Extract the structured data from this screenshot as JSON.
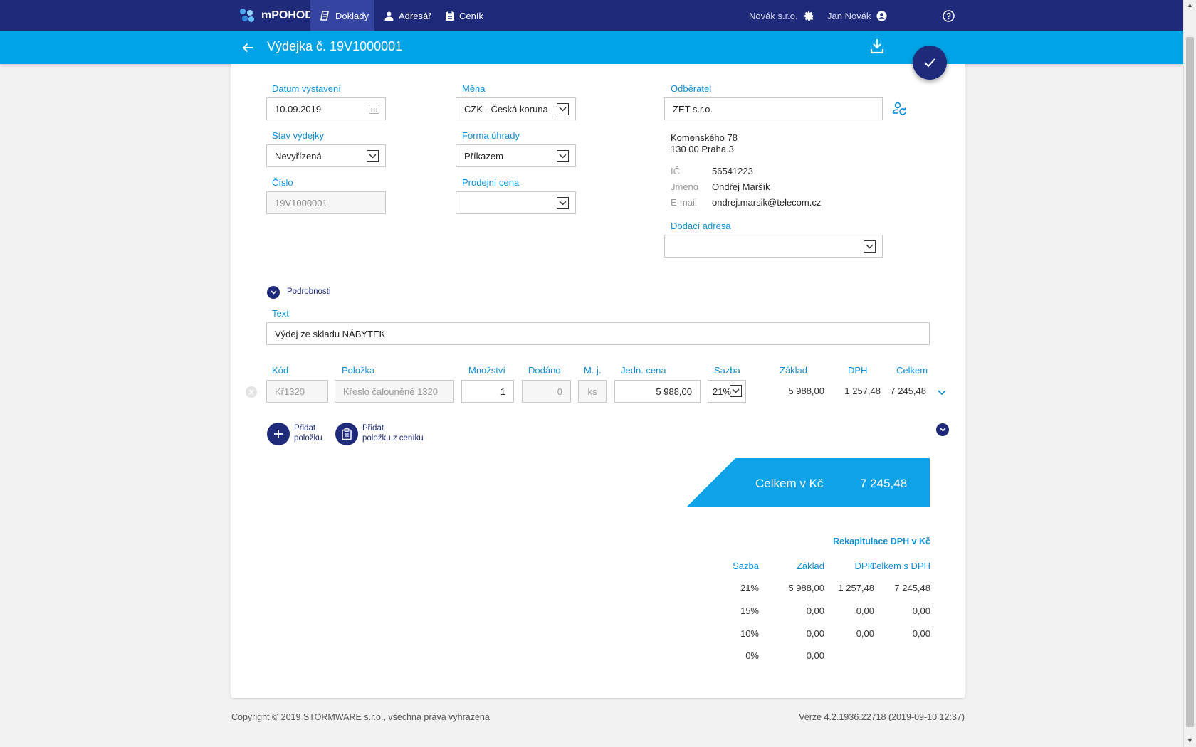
{
  "app": {
    "brand": "mPOHODA",
    "nav": [
      {
        "label": "Doklady",
        "icon": "documents-icon"
      },
      {
        "label": "Adresář",
        "icon": "person-icon"
      },
      {
        "label": "Ceník",
        "icon": "clipboard-icon"
      }
    ],
    "company": "Novák s.r.o.",
    "user": "Jan Novák"
  },
  "header": {
    "title": "Výdejka č. 19V1000001"
  },
  "form": {
    "datum_label": "Datum vystavení",
    "datum_value": "10.09.2019",
    "stav_label": "Stav výdejky",
    "stav_value": "Nevyřízená",
    "cislo_label": "Číslo",
    "cislo_value": "19V1000001",
    "mena_label": "Měna",
    "mena_value": "CZK - Česká koruna",
    "forma_label": "Forma úhrady",
    "forma_value": "Příkazem",
    "prodejni_label": "Prodejní cena",
    "prodejni_value": "",
    "odberatel_label": "Odběratel",
    "odberatel_value": "ZET s.r.o.",
    "address_line1": "Komenského 78",
    "address_line2": "130 00 Praha 3",
    "ic_label": "IČ",
    "ic_value": "56541223",
    "jmeno_label": "Jméno",
    "jmeno_value": "Ondřej Maršík",
    "email_label": "E-mail",
    "email_value": "ondrej.marsik@telecom.cz",
    "dodaci_label": "Dodací adresa",
    "dodaci_value": "",
    "podrobnosti": "Podrobnosti",
    "text_label": "Text",
    "text_value": "Výdej ze skladu NÁBYTEK"
  },
  "items": {
    "headers": {
      "kod": "Kód",
      "polozka": "Položka",
      "mnozstvi": "Množství",
      "dodano": "Dodáno",
      "mj": "M. j.",
      "jedn_cena": "Jedn. cena",
      "sazba": "Sazba",
      "zaklad": "Základ",
      "dph": "DPH",
      "celkem": "Celkem"
    },
    "row": {
      "kod": "Kř1320",
      "polozka": "Křeslo čalouněné 1320",
      "mnozstvi": "1",
      "dodano": "0",
      "mj": "ks",
      "jedn_cena": "5 988,00",
      "sazba": "21%",
      "zaklad": "5 988,00",
      "dph": "1 257,48",
      "celkem": "7 245,48"
    },
    "add_item_line1": "Přidat",
    "add_item_line2": "položku",
    "add_price_line1": "Přidat",
    "add_price_line2": "položku z ceníku"
  },
  "total": {
    "label": "Celkem v Kč",
    "value": "7 245,48"
  },
  "recap": {
    "title": "Rekapitulace DPH v Kč",
    "headers": {
      "sazba": "Sazba",
      "zaklad": "Základ",
      "dph": "DPH",
      "celkem": "Celkem s DPH"
    },
    "rows": [
      {
        "sazba": "21%",
        "zaklad": "5 988,00",
        "dph": "1 257,48",
        "celkem": "7 245,48"
      },
      {
        "sazba": "15%",
        "zaklad": "0,00",
        "dph": "0,00",
        "celkem": "0,00"
      },
      {
        "sazba": "10%",
        "zaklad": "0,00",
        "dph": "0,00",
        "celkem": "0,00"
      },
      {
        "sazba": "0%",
        "zaklad": "0,00",
        "dph": "",
        "celkem": ""
      }
    ]
  },
  "footer": {
    "copyright": "Copyright © 2019 STORMWARE s.r.o., všechna práva vyhrazena",
    "version": "Verze 4.2.1936.22718 (2019-09-10 12:37)"
  },
  "colors": {
    "nav_bg": "#1f2a7a",
    "header_bg": "#00a4e6",
    "label": "#0c8fd6",
    "total_bg": "#0ea3e8"
  }
}
